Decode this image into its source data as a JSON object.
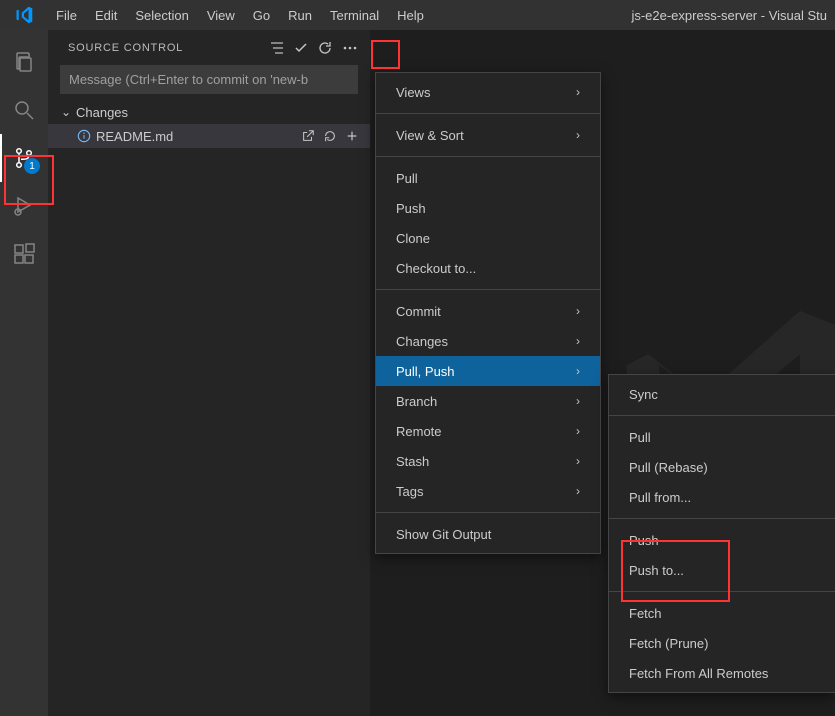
{
  "window": {
    "title": "js-e2e-express-server - Visual Stu"
  },
  "menubar": [
    "File",
    "Edit",
    "Selection",
    "View",
    "Go",
    "Run",
    "Terminal",
    "Help"
  ],
  "activity": {
    "scm_badge": "1"
  },
  "scm": {
    "panel_title": "SOURCE CONTROL",
    "commit_placeholder": "Message (Ctrl+Enter to commit on 'new-b",
    "section_changes": "Changes",
    "file": "README.md"
  },
  "menu_main": {
    "views": "Views",
    "view_sort": "View & Sort",
    "pull": "Pull",
    "push": "Push",
    "clone": "Clone",
    "checkout": "Checkout to...",
    "commit": "Commit",
    "changes": "Changes",
    "pull_push": "Pull, Push",
    "branch": "Branch",
    "remote": "Remote",
    "stash": "Stash",
    "tags": "Tags",
    "show_git_output": "Show Git Output"
  },
  "menu_sub": {
    "sync": "Sync",
    "pull": "Pull",
    "pull_rebase": "Pull (Rebase)",
    "pull_from": "Pull from...",
    "push": "Push",
    "push_to": "Push to...",
    "fetch": "Fetch",
    "fetch_prune": "Fetch (Prune)",
    "fetch_all": "Fetch From All Remotes"
  }
}
